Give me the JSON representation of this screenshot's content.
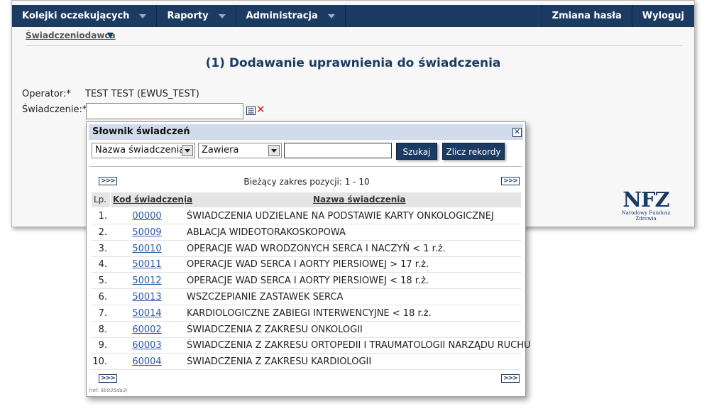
{
  "nav": {
    "items": [
      "Kolejki oczekujących",
      "Raporty",
      "Administracja"
    ],
    "right": [
      "Zmiana hasła",
      "Wyloguj"
    ]
  },
  "breadcrumb": "Świadczeniodawca",
  "page_title": "(1) Dodawanie uprawnienia do świadczenia",
  "form": {
    "operator_label": "Operator:*",
    "operator_value": "TEST TEST (EWUS_TEST)",
    "service_label": "Świadczenie:*",
    "service_value": ""
  },
  "logo": {
    "mark": "NFZ",
    "subtitle": "Narodowy Fundusz Zdrowia"
  },
  "dialog": {
    "title": "Słownik świadczeń",
    "field_select": "Nazwa świadczenia",
    "mode_select": "Zawiera",
    "search_value": "",
    "search_button": "Szukaj",
    "count_button": "Zlicz rekordy",
    "pager_next": ">>>",
    "range_text": "Bieżący zakres pozycji: 1 - 10",
    "columns": {
      "lp": "Lp.",
      "kod": "Kod świadczenia",
      "nazwa": "Nazwa świadczenia"
    },
    "rows": [
      {
        "lp": "1.",
        "kod": "00000",
        "nazwa": "ŚWIADCZENIA UDZIELANE NA PODSTAWIE KARTY ONKOLOGICZNEJ"
      },
      {
        "lp": "2.",
        "kod": "50009",
        "nazwa": "ABLACJA WIDEOTORAKOSKOPOWA"
      },
      {
        "lp": "3.",
        "kod": "50010",
        "nazwa": "OPERACJE WAD WRODZONYCH SERCA I NACZYŃ < 1 r.ż."
      },
      {
        "lp": "4.",
        "kod": "50011",
        "nazwa": "OPERACJE WAD SERCA I AORTY PIERSIOWEJ > 17 r.ż."
      },
      {
        "lp": "5.",
        "kod": "50012",
        "nazwa": "OPERACJE WAD SERCA I AORTY PIERSIOWEJ < 18 r.ż."
      },
      {
        "lp": "6.",
        "kod": "50013",
        "nazwa": "WSZCZEPIANIE ZASTAWEK SERCA"
      },
      {
        "lp": "7.",
        "kod": "50014",
        "nazwa": "KARDIOLOGICZNE ZABIEGI INTERWENCYJNE < 18 r.ż."
      },
      {
        "lp": "8.",
        "kod": "60002",
        "nazwa": "ŚWIADCZENIA Z ZAKRESU ONKOLOGII"
      },
      {
        "lp": "9.",
        "kod": "60003",
        "nazwa": "ŚWIADCZENIA Z ZAKRESU ORTOPEDII I TRAUMATOLOGII NARZĄDU RUCHU"
      },
      {
        "lp": "10.",
        "kod": "60004",
        "nazwa": "ŚWIADCZENIA Z ZAKRESU KARDIOLOGII"
      }
    ],
    "ref": "(ref. 6b935da3)"
  },
  "colors": {
    "navy": "#1c3b63",
    "link": "#2b56a5",
    "clear": "#d62020",
    "dialog_header": "#d1dbeb"
  }
}
